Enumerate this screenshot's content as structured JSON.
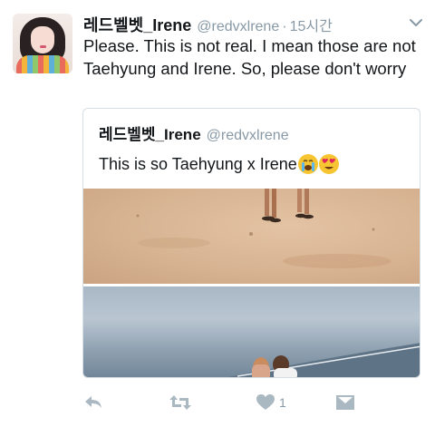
{
  "tweet": {
    "display_name": "레드벨벳_Irene",
    "handle": "@redvxlrene",
    "separator": "·",
    "time": "15시간",
    "text": "Please. This is not real. I mean those are not Taehyung and Irene. So, please don't worry",
    "avatar_icon": "profile-photo"
  },
  "quoted_tweet": {
    "display_name": "레드벨벳_Irene",
    "handle": "@redvxlrene",
    "text": "This is so Taehyung x Irene",
    "emojis": [
      "crying-face-emoji",
      "heart-eyes-emoji"
    ],
    "photos": [
      "beach-sand-photo",
      "beach-sea-photo"
    ]
  },
  "actions": {
    "reply_icon": "reply-icon",
    "retweet_icon": "retweet-icon",
    "like_icon": "heart-icon",
    "like_count": "1",
    "dm_icon": "envelope-icon"
  },
  "colors": {
    "text": "#14171a",
    "secondary": "#8899a6",
    "border": "#d6dde3",
    "icon": "#aab8c2"
  }
}
